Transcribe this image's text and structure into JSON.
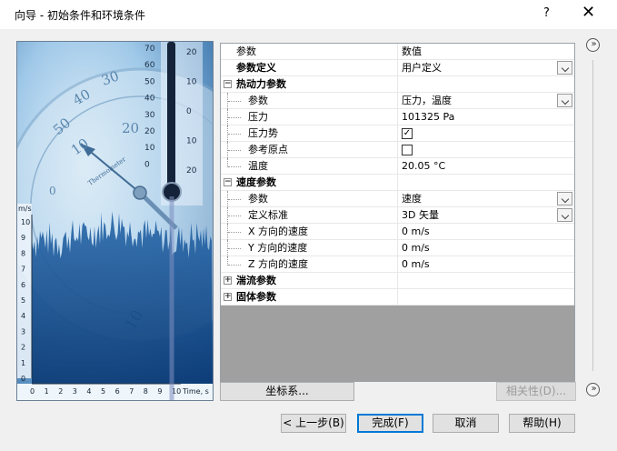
{
  "window": {
    "title": "向导 - 初始条件和环境条件",
    "help": "?",
    "close": "✕"
  },
  "illustration": {
    "y_unit": "m/s",
    "y_ticks": [
      "0",
      "1",
      "2",
      "3",
      "4",
      "5",
      "6",
      "7",
      "8",
      "9",
      "10"
    ],
    "x_ticks": [
      "0",
      "1",
      "2",
      "3",
      "4",
      "5",
      "6",
      "7",
      "8",
      "9",
      "10"
    ],
    "x_unit": "Time, s",
    "thermo_left": [
      "70",
      "60",
      "50",
      "40",
      "30",
      "20",
      "10",
      "0"
    ],
    "thermo_right": [
      "20",
      "10",
      "0",
      "10",
      "20"
    ],
    "dial_label": "Thermometer",
    "dial_numbers": [
      "50",
      "40",
      "30",
      "20",
      "10",
      "0",
      "10"
    ]
  },
  "grid": {
    "header": {
      "name": "参数",
      "value": "数值"
    },
    "definition": {
      "name": "参数定义",
      "value": "用户定义"
    },
    "thermo": {
      "group": "热动力参数",
      "rows": [
        {
          "name": "参数",
          "value": "压力，温度"
        },
        {
          "name": "压力",
          "value": "101325 Pa"
        },
        {
          "name": "压力势",
          "value": "✓"
        },
        {
          "name": "参考原点",
          "value": ""
        },
        {
          "name": "温度",
          "value": "20.05 °C"
        }
      ]
    },
    "velocity": {
      "group": "速度参数",
      "rows": [
        {
          "name": "参数",
          "value": "速度"
        },
        {
          "name": "定义标准",
          "value": "3D 矢量"
        },
        {
          "name": "X 方向的速度",
          "value": "0 m/s"
        },
        {
          "name": "Y 方向的速度",
          "value": "0 m/s"
        },
        {
          "name": "Z 方向的速度",
          "value": "0 m/s"
        }
      ]
    },
    "turbulence": {
      "group": "湍流参数"
    },
    "solid": {
      "group": "固体参数"
    }
  },
  "buttons": {
    "coordinate": "坐标系...",
    "dependency": "相关性(D)...",
    "back": "< 上一步(B)",
    "finish": "完成(F)",
    "cancel": "取消",
    "help": "帮助(H)"
  },
  "collapse_glyph": "»",
  "expander_minus": "−",
  "expander_plus": "+",
  "colors": {
    "accent": "#0078d7",
    "grid_empty": "#a0a0a0"
  }
}
